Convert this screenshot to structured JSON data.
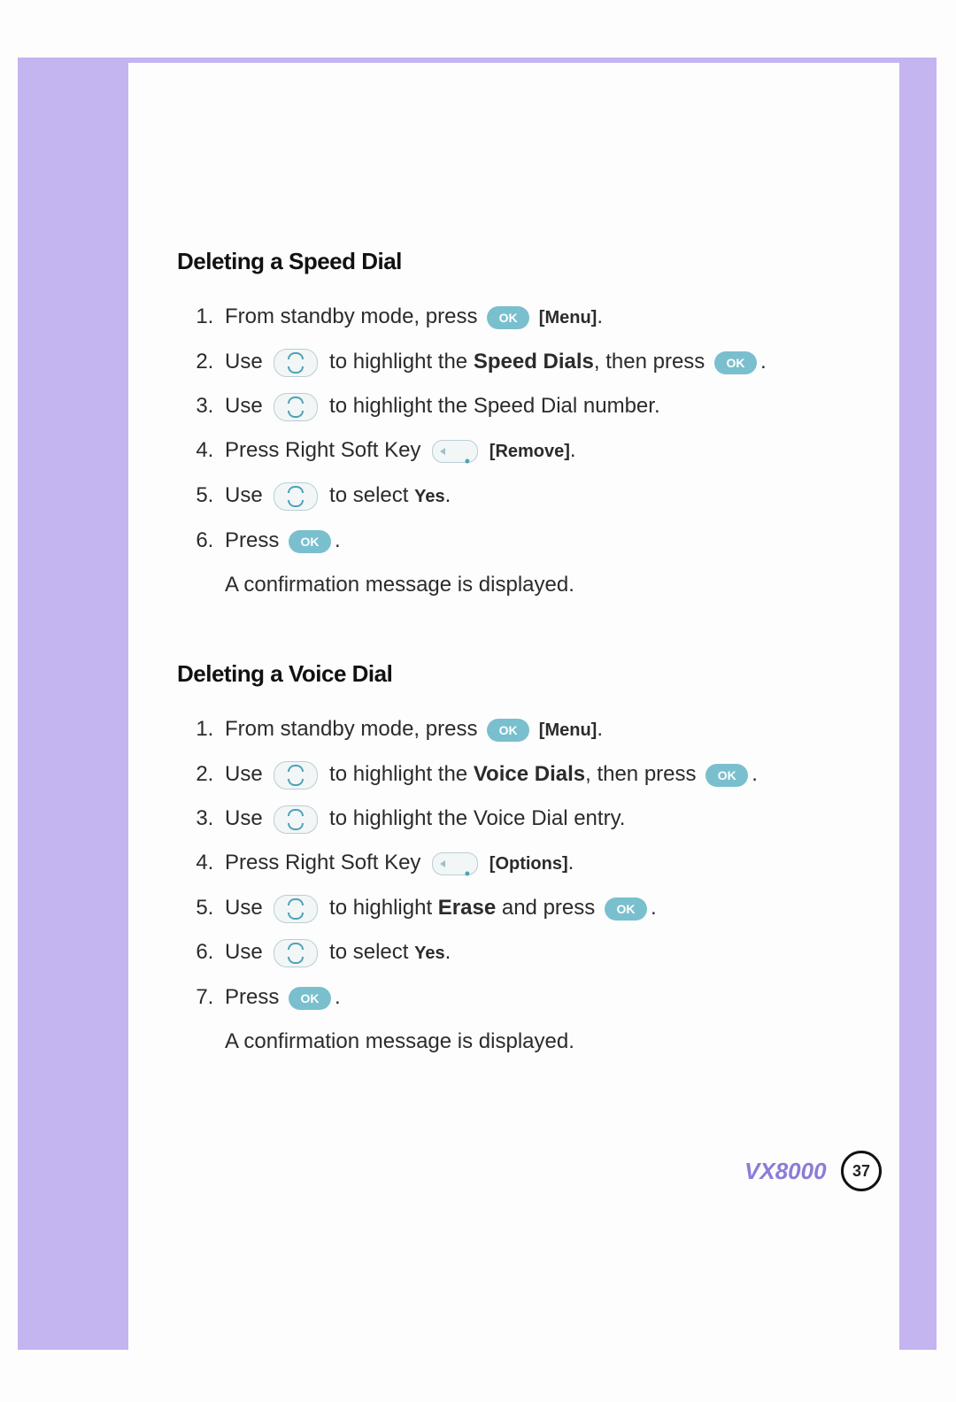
{
  "section1": {
    "heading": "Deleting a Speed Dial",
    "steps": {
      "s1a": "From standby mode, press",
      "s1_menu": "[Menu]",
      "s2a": "Use",
      "s2b": "to highlight the",
      "s2_bold": "Speed Dials",
      "s2c": ", then press",
      "s3a": "Use",
      "s3b": "to highlight the Speed Dial number.",
      "s4a": "Press Right Soft Key",
      "s4_label": "[Remove]",
      "s5a": "Use",
      "s5b": "to select",
      "s5_yes": "Yes",
      "s6a": "Press",
      "s6b": "A confirmation message is displayed."
    }
  },
  "section2": {
    "heading": "Deleting a Voice Dial",
    "steps": {
      "s1a": "From standby mode, press",
      "s1_menu": "[Menu]",
      "s2a": "Use",
      "s2b": "to highlight the",
      "s2_bold": "Voice Dials",
      "s2c": ", then press",
      "s3a": "Use",
      "s3b": "to highlight the Voice Dial entry.",
      "s4a": "Press Right Soft Key",
      "s4_label": "[Options]",
      "s5a": "Use",
      "s5b": "to highlight",
      "s5_bold": "Erase",
      "s5c": "and press",
      "s6a": "Use",
      "s6b": "to select",
      "s6_yes": "Yes",
      "s7a": "Press",
      "s7b": "A confirmation message is displayed."
    }
  },
  "footer": {
    "model": "VX8000",
    "page": "37"
  },
  "icons": {
    "ok": "OK"
  }
}
